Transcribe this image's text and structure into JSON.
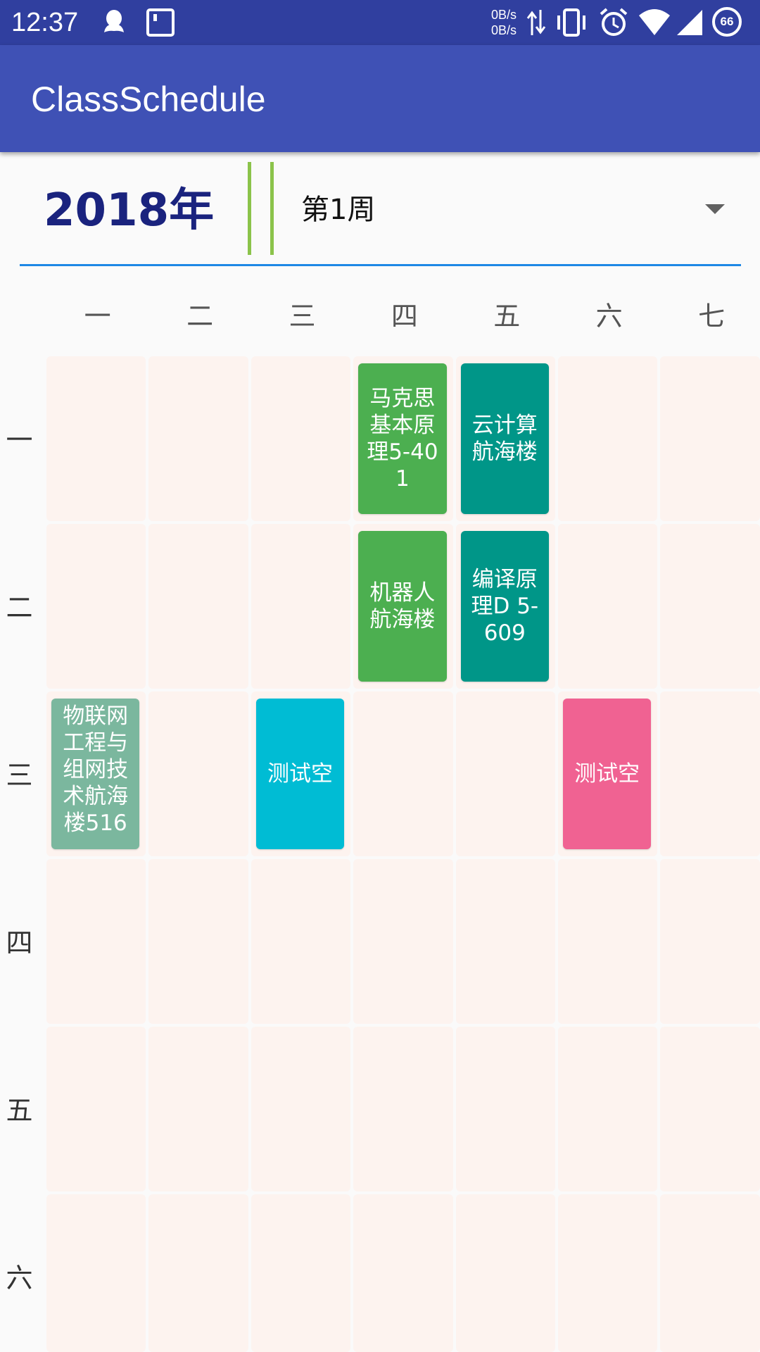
{
  "status_bar": {
    "time": "12:37",
    "net_speed_up": "0B/s",
    "net_speed_down": "0B/s",
    "battery_level": "66",
    "icons": [
      "qq-icon",
      "sim-icon",
      "data-arrows-icon",
      "vibrate-icon",
      "alarm-icon",
      "wifi-icon",
      "signal-icon",
      "battery-icon"
    ]
  },
  "app_bar": {
    "title": "ClassSchedule"
  },
  "header": {
    "year": "2018年",
    "week": "第1周"
  },
  "days": [
    "一",
    "二",
    "三",
    "四",
    "五",
    "六",
    "七"
  ],
  "periods": [
    "一",
    "二",
    "三",
    "四",
    "五",
    "六"
  ],
  "courses": [
    {
      "text": "马克思基本原理5-401",
      "day": 4,
      "period": 1,
      "color": "#4caf50"
    },
    {
      "text": "云计算航海楼",
      "day": 5,
      "period": 1,
      "color": "#009688"
    },
    {
      "text": "机器人航海楼",
      "day": 4,
      "period": 2,
      "color": "#4caf50"
    },
    {
      "text": "编译原理D 5-609",
      "day": 5,
      "period": 2,
      "color": "#009688"
    },
    {
      "text": "物联网工程与组网技术航海楼516",
      "day": 1,
      "period": 3,
      "color": "#7bb79e"
    },
    {
      "text": "测试空",
      "day": 3,
      "period": 3,
      "color": "#00bcd4"
    },
    {
      "text": "测试空",
      "day": 6,
      "period": 3,
      "color": "#f06292"
    }
  ],
  "colors": {
    "status_bar": "#303f9f",
    "app_bar": "#3f51b5",
    "year_text": "#1a237e",
    "divider": "#8bc34a",
    "underline": "#1e88e5",
    "cell_background": "#fdf3ef"
  }
}
